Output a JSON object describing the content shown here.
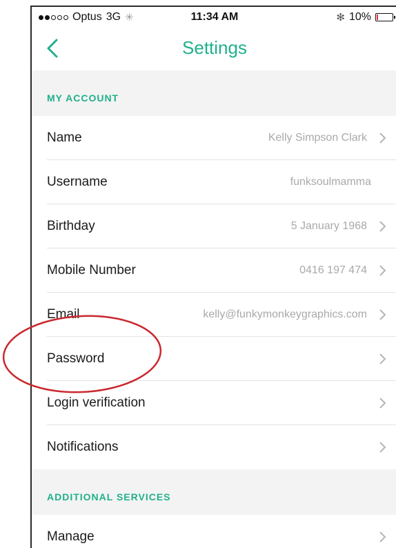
{
  "status_bar": {
    "carrier": "Optus",
    "network": "3G",
    "activity_glyph": "✳",
    "time": "11:34 AM",
    "bluetooth_glyph": "✻",
    "battery_percent": "10%",
    "battery_level": 0.1,
    "battery_fill_color": "#e33333"
  },
  "nav": {
    "title": "Settings",
    "back_icon": "chevron-left-icon"
  },
  "colors": {
    "accent": "#20b08c",
    "section_bg": "#f3f3f3",
    "annotation_circle": "#c8282e"
  },
  "sections": {
    "my_account": "MY ACCOUNT",
    "additional_services": "ADDITIONAL SERVICES"
  },
  "rows": {
    "name": {
      "label": "Name",
      "value": "Kelly Simpson Clark"
    },
    "username": {
      "label": "Username",
      "value": "funksoulmamma"
    },
    "birthday": {
      "label": "Birthday",
      "value": "5 January 1968"
    },
    "mobile": {
      "label": "Mobile Number",
      "value": "0416 197 474"
    },
    "email": {
      "label": "Email",
      "value": "kelly@funkymonkeygraphics.com"
    },
    "password": {
      "label": "Password",
      "value": ""
    },
    "login_verification": {
      "label": "Login verification",
      "value": ""
    },
    "notifications": {
      "label": "Notifications",
      "value": ""
    },
    "manage": {
      "label": "Manage",
      "value": ""
    }
  }
}
